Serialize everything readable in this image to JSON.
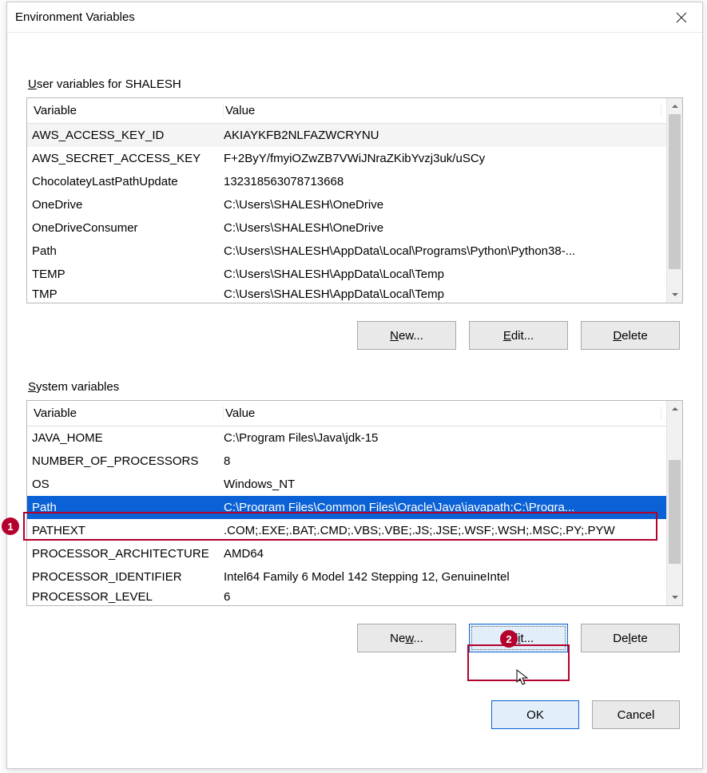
{
  "title": "Environment Variables",
  "user_section": {
    "label_pre": "U",
    "label_rest": "ser variables for SHALESH",
    "headers": {
      "variable": "Variable",
      "value": "Value"
    },
    "rows": [
      {
        "variable": "AWS_ACCESS_KEY_ID",
        "value": "AKIAYKFB2NLFAZWCRYNU"
      },
      {
        "variable": "AWS_SECRET_ACCESS_KEY",
        "value": "F+2ByY/fmyiOZwZB7VWiJNraZKibYvzj3uk/uSCy"
      },
      {
        "variable": "ChocolateyLastPathUpdate",
        "value": "132318563078713668"
      },
      {
        "variable": "OneDrive",
        "value": "C:\\Users\\SHALESH\\OneDrive"
      },
      {
        "variable": "OneDriveConsumer",
        "value": "C:\\Users\\SHALESH\\OneDrive"
      },
      {
        "variable": "Path",
        "value": "C:\\Users\\SHALESH\\AppData\\Local\\Programs\\Python\\Python38-..."
      },
      {
        "variable": "TEMP",
        "value": "C:\\Users\\SHALESH\\AppData\\Local\\Temp"
      },
      {
        "variable": "TMP",
        "value": "C:\\Users\\SHALESH\\AppData\\Local\\Temp"
      }
    ],
    "buttons": {
      "new_pre": "N",
      "new_rest": "ew...",
      "edit_pre": "E",
      "edit_rest": "dit...",
      "delete_pre": "D",
      "delete_rest": "elete"
    }
  },
  "system_section": {
    "label_pre": "S",
    "label_rest": "ystem variables",
    "headers": {
      "variable": "Variable",
      "value": "Value"
    },
    "rows": [
      {
        "variable": "JAVA_HOME",
        "value": "C:\\Program Files\\Java\\jdk-15"
      },
      {
        "variable": "NUMBER_OF_PROCESSORS",
        "value": "8"
      },
      {
        "variable": "OS",
        "value": "Windows_NT"
      },
      {
        "variable": "Path",
        "value": "C:\\Program Files\\Common Files\\Oracle\\Java\\javapath;C:\\Progra..."
      },
      {
        "variable": "PATHEXT",
        "value": ".COM;.EXE;.BAT;.CMD;.VBS;.VBE;.JS;.JSE;.WSF;.WSH;.MSC;.PY;.PYW"
      },
      {
        "variable": "PROCESSOR_ARCHITECTURE",
        "value": "AMD64"
      },
      {
        "variable": "PROCESSOR_IDENTIFIER",
        "value": "Intel64 Family 6 Model 142 Stepping 12, GenuineIntel"
      },
      {
        "variable": "PROCESSOR_LEVEL",
        "value": "6"
      }
    ],
    "buttons": {
      "new_rest_full": "Ne",
      "new_u": "w",
      "new_tail": "...",
      "edit_rest_full": "Ed",
      "edit_u": "i",
      "edit_tail": "t...",
      "delete_rest_full": "De",
      "delete_u": "l",
      "delete_tail": "ete"
    }
  },
  "footer": {
    "ok": "OK",
    "cancel": "Cancel"
  },
  "annotations": {
    "badge1": "1",
    "badge2": "2"
  }
}
